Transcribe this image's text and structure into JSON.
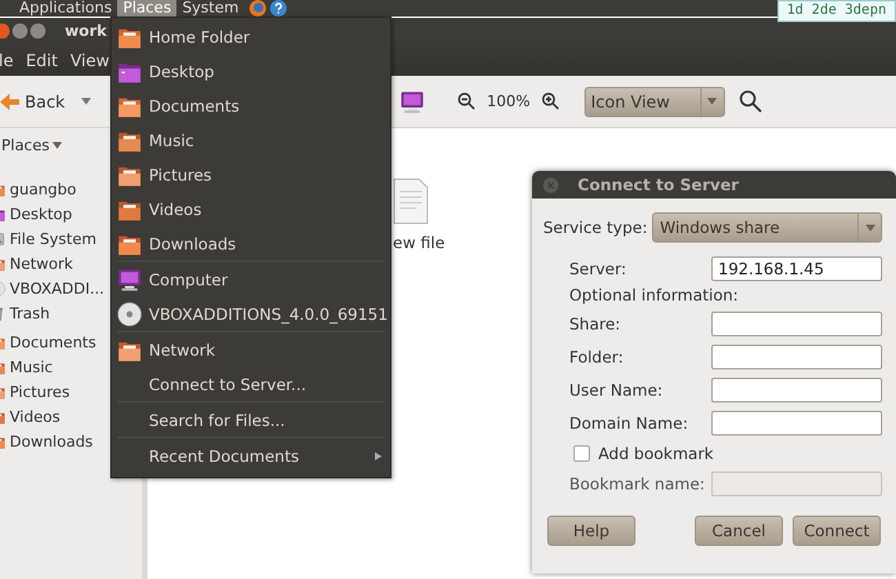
{
  "top_panel": {
    "menus": [
      {
        "label": "Applications",
        "selected": false
      },
      {
        "label": "Places",
        "selected": true
      },
      {
        "label": "System",
        "selected": false
      }
    ],
    "workspace_text": "1d 2de 3depn"
  },
  "file_manager": {
    "title": "work",
    "menus": [
      "le",
      "Edit",
      "View"
    ],
    "back_label": "Back",
    "zoom": "100%",
    "view_mode": "Icon View",
    "sidebar": {
      "heading": "Places",
      "groups": [
        [
          {
            "kind": "home",
            "label": "guangbo"
          },
          {
            "kind": "desktop",
            "label": "Desktop"
          },
          {
            "kind": "drive",
            "label": "File System"
          },
          {
            "kind": "network",
            "label": "Network"
          },
          {
            "kind": "disc",
            "label": "VBOXADDI..."
          },
          {
            "kind": "trash",
            "label": "Trash"
          }
        ],
        [
          {
            "kind": "folder",
            "label": "Documents"
          },
          {
            "kind": "music",
            "label": "Music"
          },
          {
            "kind": "pictures",
            "label": "Pictures"
          },
          {
            "kind": "videos",
            "label": "Videos"
          },
          {
            "kind": "downloads",
            "label": "Downloads"
          }
        ]
      ]
    },
    "files": [
      {
        "name": "ew file"
      }
    ]
  },
  "places_menu": {
    "groups": [
      [
        {
          "kind": "home",
          "label": "Home Folder"
        },
        {
          "kind": "desktop",
          "label": "Desktop"
        },
        {
          "kind": "folder",
          "label": "Documents"
        },
        {
          "kind": "music",
          "label": "Music"
        },
        {
          "kind": "pictures",
          "label": "Pictures"
        },
        {
          "kind": "videos",
          "label": "Videos"
        },
        {
          "kind": "downloads",
          "label": "Downloads"
        }
      ],
      [
        {
          "kind": "computer",
          "label": "Computer"
        },
        {
          "kind": "disc",
          "label": "VBOXADDITIONS_4.0.0_69151"
        }
      ],
      [
        {
          "kind": "network",
          "label": "Network"
        },
        {
          "kind": "plain",
          "label": "Connect to Server..."
        }
      ],
      [
        {
          "kind": "plain",
          "label": "Search for Files..."
        }
      ],
      [
        {
          "kind": "submenu",
          "label": "Recent Documents"
        }
      ]
    ]
  },
  "dialog": {
    "title": "Connect to Server",
    "service_type_label": "Service type:",
    "service_type": "Windows share",
    "server": {
      "label": "Server:",
      "value": "192.168.1.45"
    },
    "optional_label": "Optional information:",
    "fields": [
      {
        "label": "Share:"
      },
      {
        "label": "Folder:"
      },
      {
        "label": "User Name:"
      },
      {
        "label": "Domain Name:"
      }
    ],
    "bookmark_checkbox": {
      "label": "Add bookmark",
      "checked": false
    },
    "bookmark_name": {
      "label": "Bookmark name:",
      "disabled": true
    },
    "buttons": [
      {
        "kind": "left",
        "label": "Help"
      },
      {
        "kind": "right",
        "label": "Cancel"
      },
      {
        "kind": "right",
        "label": "Connect"
      }
    ]
  }
}
